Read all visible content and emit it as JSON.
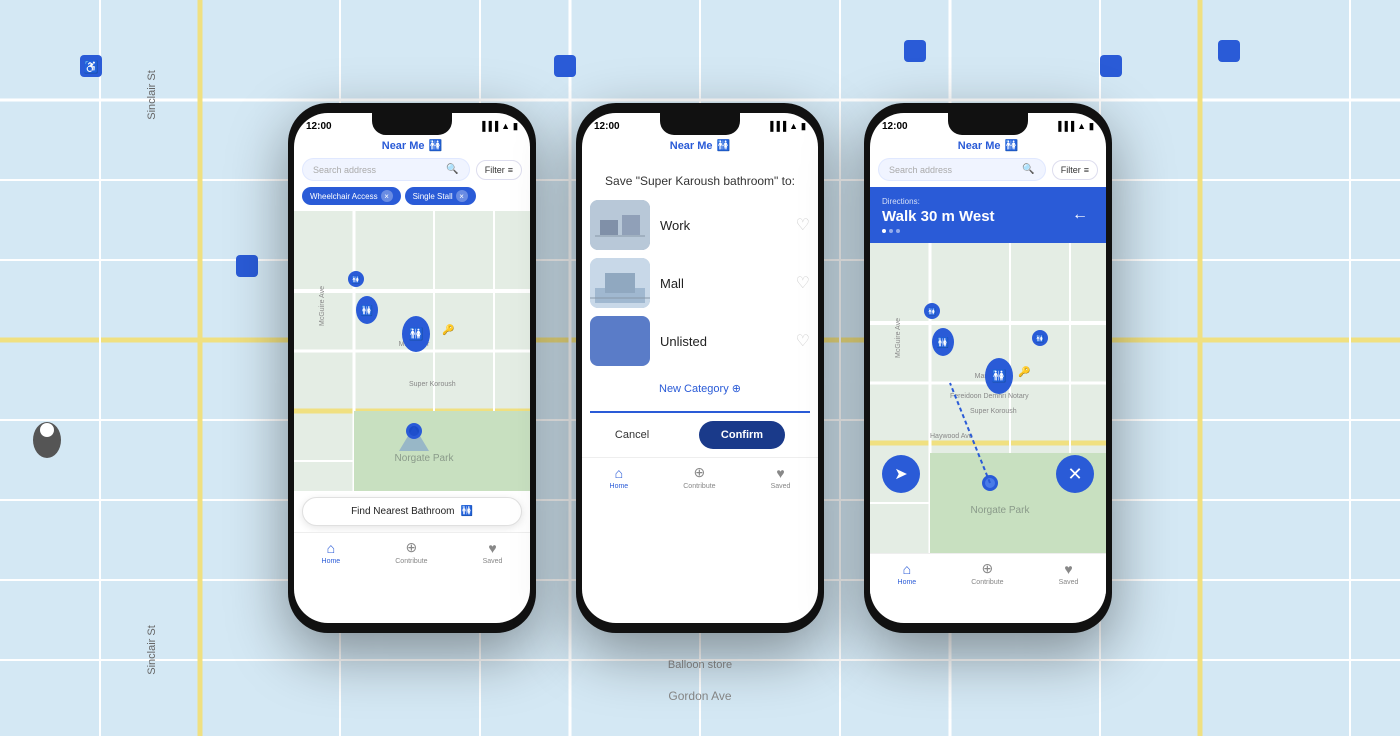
{
  "background": {
    "color": "#d0e4f5"
  },
  "phone1": {
    "status_time": "12:00",
    "app_title": "Near Me",
    "search_placeholder": "Search address",
    "filter_label": "Filter",
    "chip1": "Wheelchair Access",
    "chip2": "Single Stall",
    "find_btn": "Find Nearest Bathroom",
    "tabs": [
      {
        "label": "Home",
        "active": true
      },
      {
        "label": "Contribute",
        "active": false
      },
      {
        "label": "Saved",
        "active": false
      }
    ]
  },
  "phone2": {
    "status_time": "12:00",
    "app_title": "Near Me",
    "save_title": "Save \"Super Karoush bathroom\" to:",
    "option1": "Work",
    "option2": "Mall",
    "option3": "Unlisted",
    "new_category": "New Category",
    "cancel_label": "Cancel",
    "confirm_label": "Confirm",
    "tabs": [
      {
        "label": "Home",
        "active": true
      },
      {
        "label": "Contribute",
        "active": false
      },
      {
        "label": "Saved",
        "active": false
      }
    ]
  },
  "phone3": {
    "status_time": "12:00",
    "app_title": "Near Me",
    "search_placeholder": "Search address",
    "filter_label": "Filter",
    "directions_label": "Directions:",
    "directions_text": "Walk 30 m West",
    "tabs": [
      {
        "label": "Home",
        "active": true
      },
      {
        "label": "Contribute",
        "active": false
      },
      {
        "label": "Saved",
        "active": false
      }
    ]
  }
}
